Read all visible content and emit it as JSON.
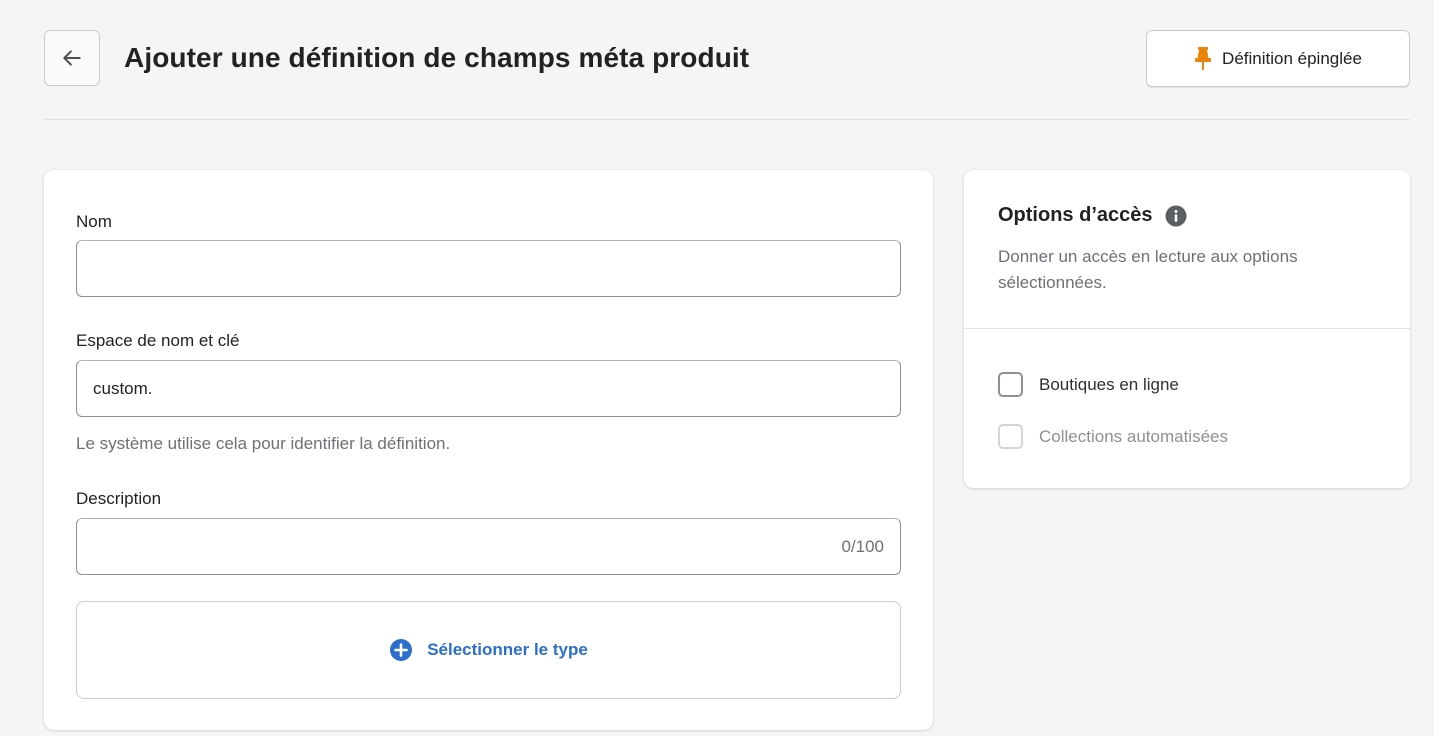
{
  "header": {
    "title": "Ajouter une définition de champs méta produit",
    "back_icon": "arrow-left-icon",
    "pin_button_label": "Définition épinglée",
    "pin_icon": "pin-icon",
    "pin_color": "#e8830b"
  },
  "form": {
    "name_label": "Nom",
    "name_value": "",
    "namespace_label": "Espace de nom et clé",
    "namespace_value": "custom.",
    "namespace_help": "Le système utilise cela pour identifier la définition.",
    "description_label": "Description",
    "description_value": "",
    "description_counter": "0/100",
    "select_type_label": "Sélectionner le type",
    "select_type_icon": "plus-circle-icon",
    "accent_color": "#2c6ecb"
  },
  "access": {
    "title": "Options d’accès",
    "info_icon": "info-icon",
    "description": "Donner un accès en lecture aux options sélectionnées.",
    "options": [
      {
        "label": "Boutiques en ligne",
        "checked": false,
        "disabled": false
      },
      {
        "label": "Collections automatisées",
        "checked": false,
        "disabled": true
      }
    ]
  }
}
